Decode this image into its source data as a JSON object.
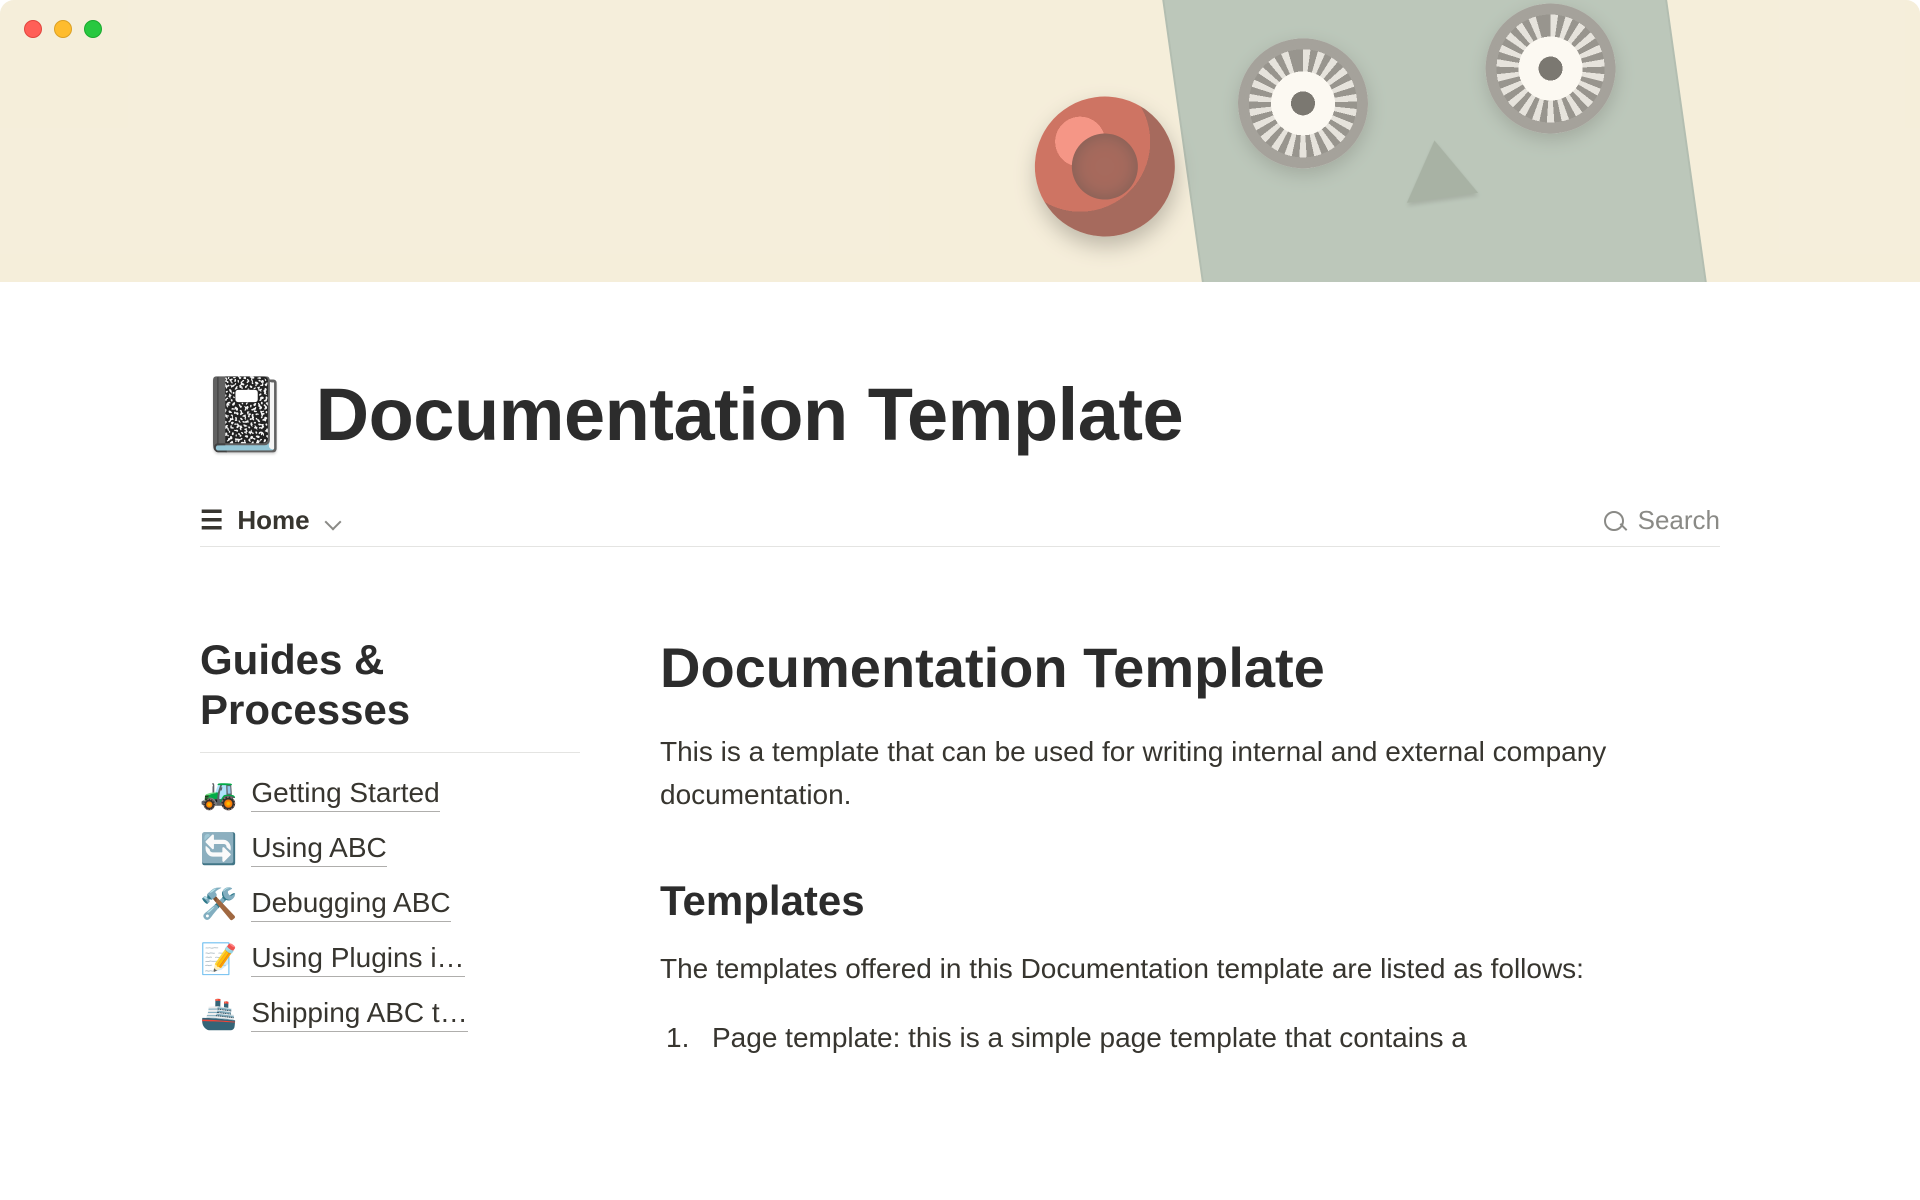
{
  "page": {
    "icon": "📓",
    "title": "Documentation Template"
  },
  "viewbar": {
    "view_label": "Home",
    "search_label": "Search"
  },
  "sidebar": {
    "heading": "Guides & Processes",
    "items": [
      {
        "emoji": "🚜",
        "label": "Getting Started"
      },
      {
        "emoji": "🔄",
        "label": "Using ABC"
      },
      {
        "emoji": "🛠️",
        "label": "Debugging ABC"
      },
      {
        "emoji": "📝",
        "label": "Using Plugins i…"
      },
      {
        "emoji": "🚢",
        "label": "Shipping ABC t…"
      }
    ]
  },
  "main": {
    "heading": "Documentation Template",
    "lead": "This is a template that can be used for writing internal and external company documentation.",
    "subheading": "Templates",
    "subtext": "The templates offered in this Documentation template are listed as follows:",
    "list_item_1": "Page template: this is a simple page template that contains a"
  }
}
